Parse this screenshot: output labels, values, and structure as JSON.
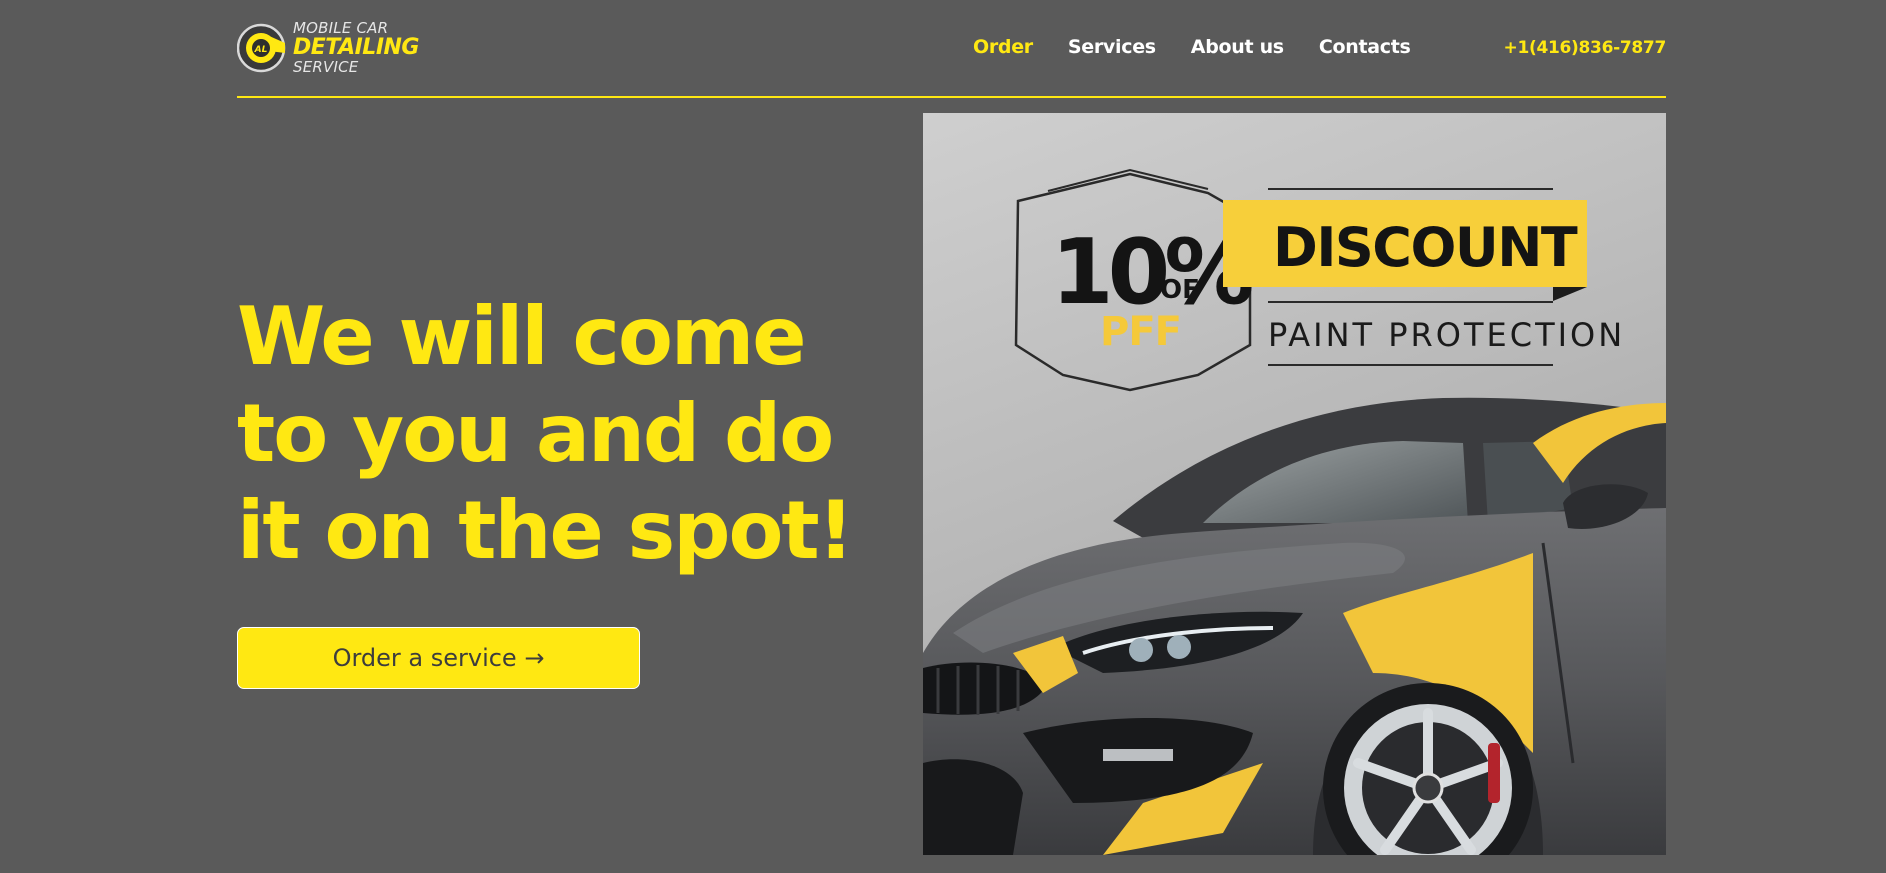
{
  "logo": {
    "line1": "MOBILE CAR",
    "line2": "DETAILING",
    "line3": "SERVICE",
    "mark_letters": "AL"
  },
  "nav": {
    "items": [
      {
        "label": "Order",
        "active": true
      },
      {
        "label": "Services",
        "active": false
      },
      {
        "label": "About us",
        "active": false
      },
      {
        "label": "Contacts",
        "active": false
      }
    ],
    "phone": "+1(416)836-7877"
  },
  "hero": {
    "title": "We will come to you and do it on the spot!",
    "cta_label": "Order a service →"
  },
  "promo": {
    "percent": "10%",
    "of_text": "OF",
    "pff_text": "PFF",
    "discount_label": "DISCOUNT",
    "subtitle": "PAINT PROTECTION"
  },
  "colors": {
    "background": "#5a5a5a",
    "accent": "#ffe812",
    "text_light": "#ffffff",
    "button_text": "#3d3d3d"
  }
}
